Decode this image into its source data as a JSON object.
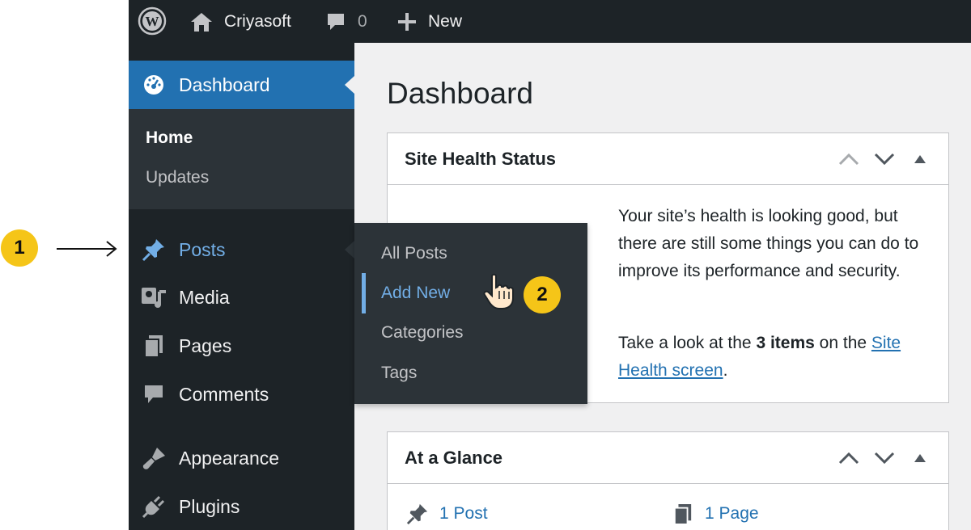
{
  "annotations": {
    "step1": "1",
    "step2": "2"
  },
  "admin_bar": {
    "site_name": "Criyasoft",
    "comments_count": "0",
    "new_label": "New"
  },
  "sidebar": {
    "dashboard_label": "Dashboard",
    "dashboard_sub": {
      "home": "Home",
      "updates": "Updates"
    },
    "items": [
      {
        "label": "Posts",
        "icon": "pin-icon"
      },
      {
        "label": "Media",
        "icon": "media-icon"
      },
      {
        "label": "Pages",
        "icon": "pages-icon"
      },
      {
        "label": "Comments",
        "icon": "comment-icon"
      },
      {
        "label": "Appearance",
        "icon": "brush-icon"
      },
      {
        "label": "Plugins",
        "icon": "plug-icon"
      }
    ]
  },
  "posts_flyout": {
    "items": [
      "All Posts",
      "Add New",
      "Categories",
      "Tags"
    ],
    "active": "Add New"
  },
  "main": {
    "page_title": "Dashboard",
    "site_health": {
      "title": "Site Health Status",
      "message": "Your site’s health is looking good, but there are still some things you can do to improve its performance and security.",
      "cta_prefix": "Take a look at the ",
      "cta_count": "3 items",
      "cta_middle": " on the ",
      "cta_link": "Site Health screen",
      "cta_suffix": "."
    },
    "at_a_glance": {
      "title": "At a Glance",
      "post_count": "1 Post",
      "page_count": "1 Page"
    }
  },
  "colors": {
    "admin_dark": "#1d2327",
    "submenu_bg": "#2c3338",
    "accent_blue": "#2271b1",
    "link_blue": "#72aee6",
    "badge_yellow": "#f5c518",
    "content_bg": "#f0f0f1"
  }
}
